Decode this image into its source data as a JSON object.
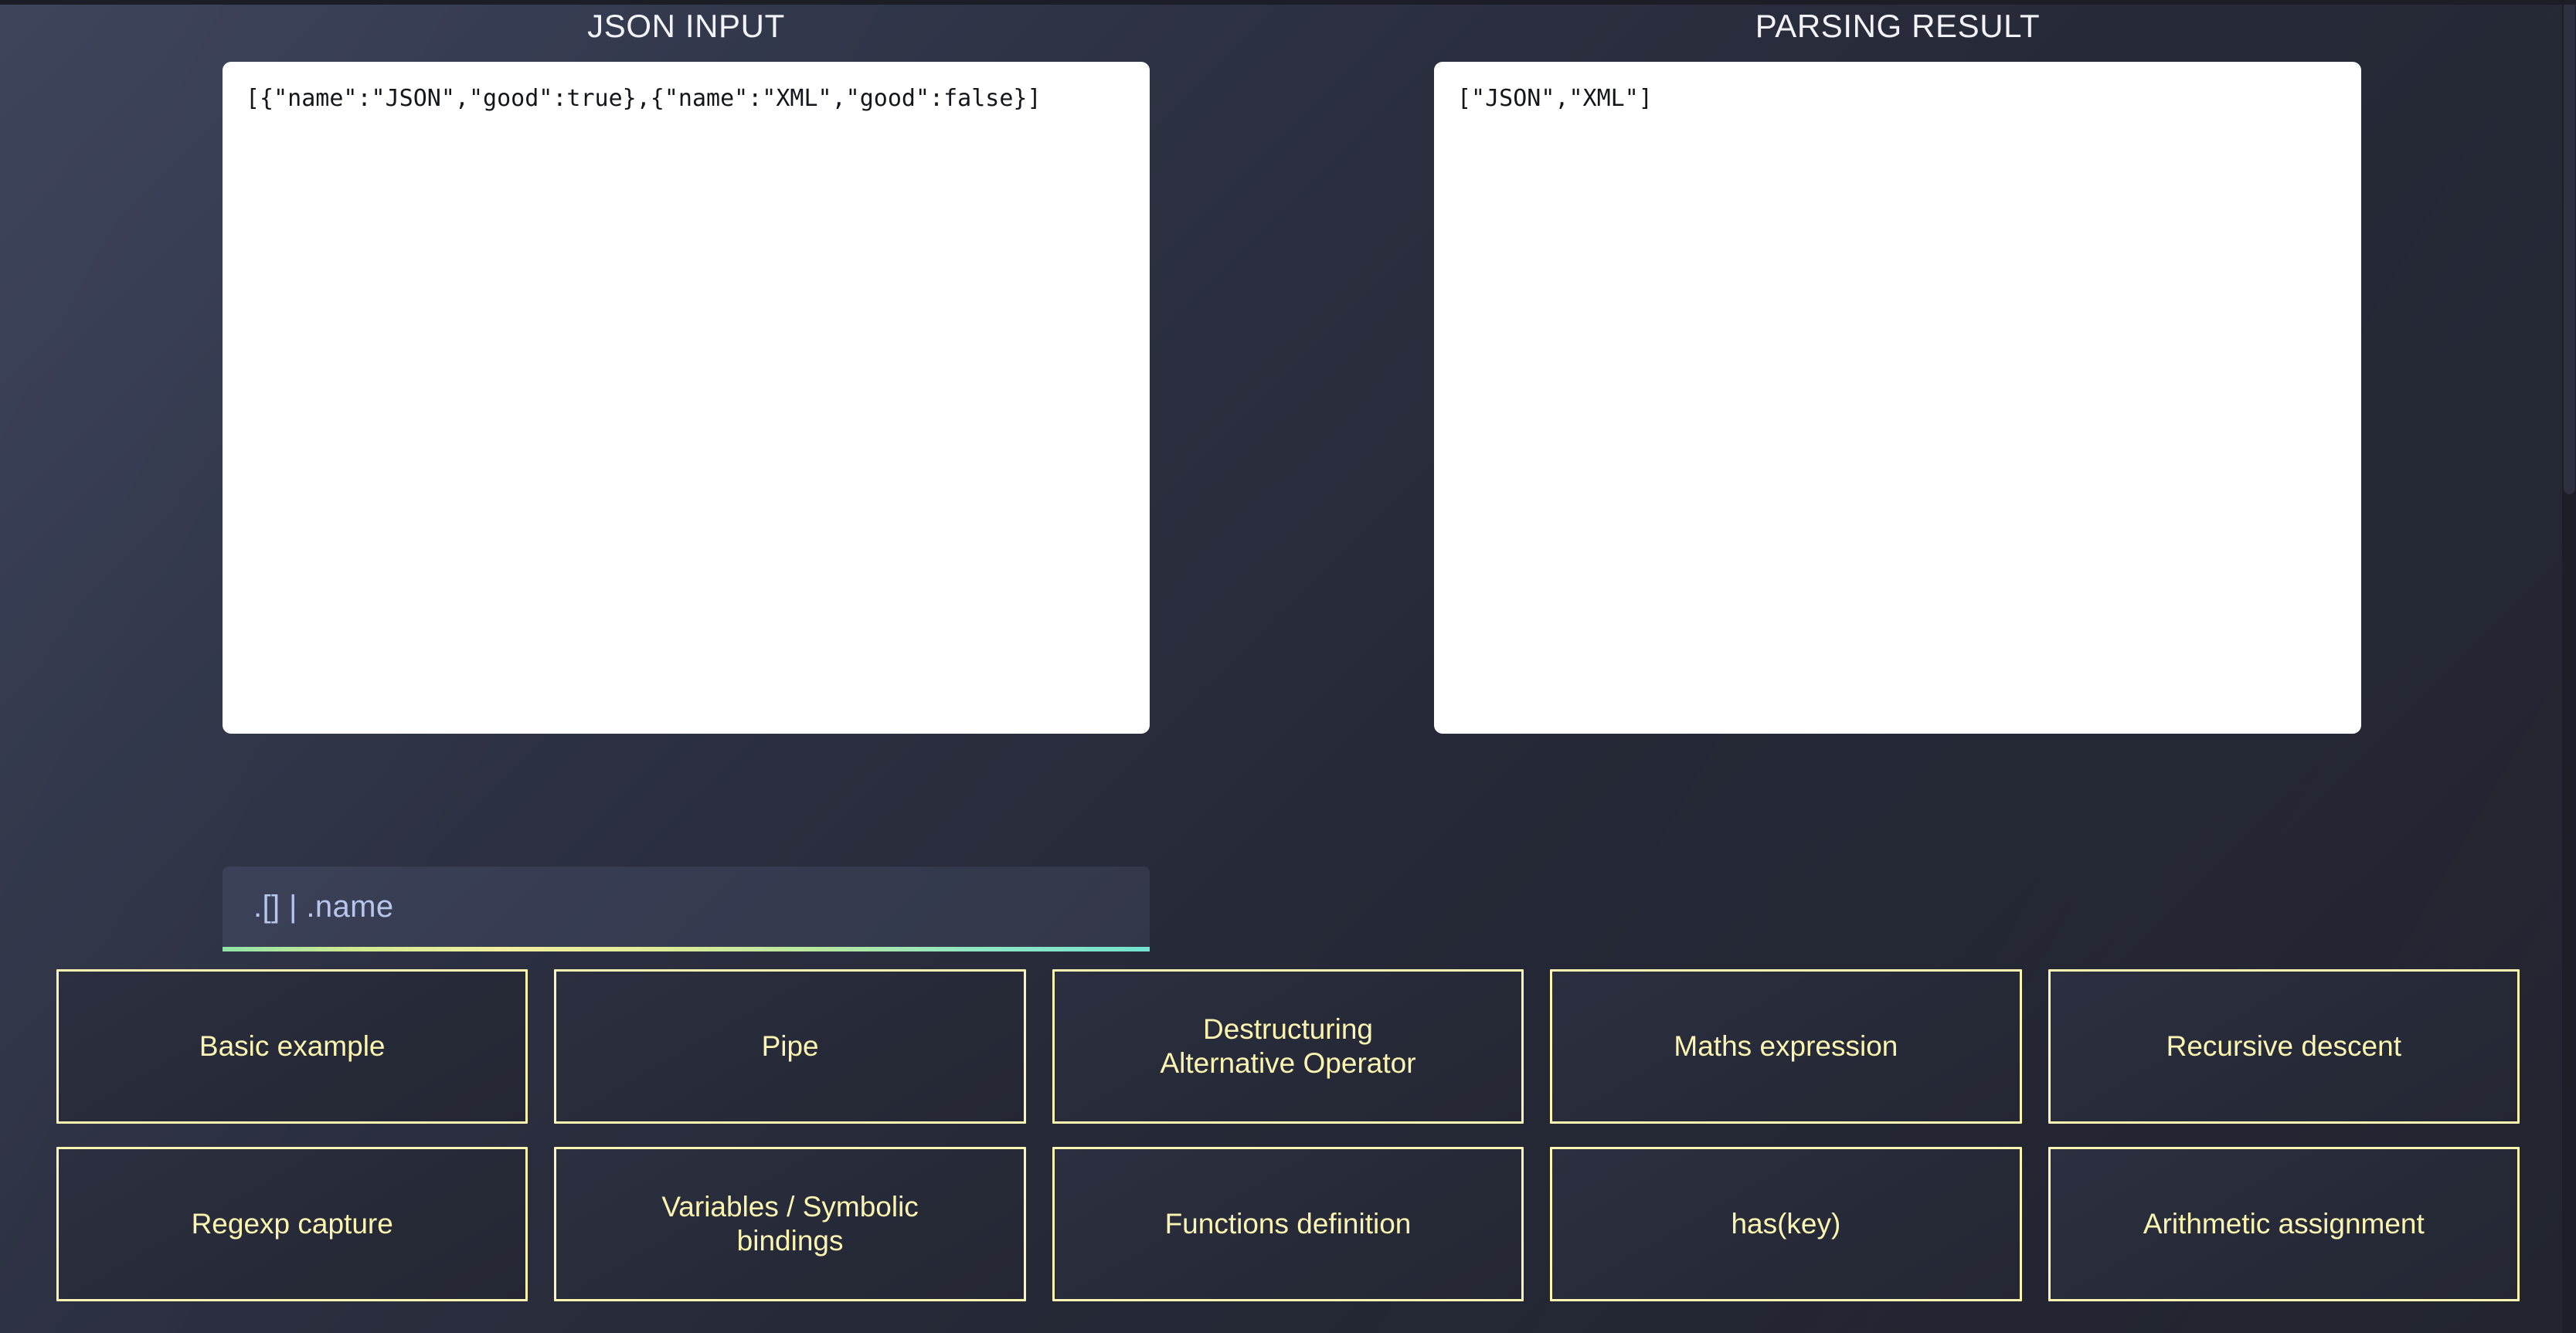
{
  "panels": {
    "input": {
      "title": "JSON INPUT",
      "value": "[{\"name\":\"JSON\",\"good\":true},{\"name\":\"XML\",\"good\":false}]"
    },
    "result": {
      "title": "PARSING RESULT",
      "value": "[\"JSON\",\"XML\"]"
    }
  },
  "query": {
    "value": ".[] | .name"
  },
  "examples": [
    {
      "label": "Basic example"
    },
    {
      "label": "Pipe"
    },
    {
      "label": "Destructuring\nAlternative Operator"
    },
    {
      "label": "Maths expression"
    },
    {
      "label": "Recursive descent"
    },
    {
      "label": "Regexp capture"
    },
    {
      "label": "Variables / Symbolic\nbindings"
    },
    {
      "label": "Functions definition"
    },
    {
      "label": "has(key)"
    },
    {
      "label": "Arithmetic assignment"
    }
  ],
  "colors": {
    "background": "#232734",
    "accent_yellow": "#fbf5b1",
    "query_text": "#b9c6ec",
    "panel_white": "#ffffff",
    "underline_start": "#8fe3a8",
    "underline_mid": "#f2efa0",
    "underline_end": "#74e3cf"
  }
}
